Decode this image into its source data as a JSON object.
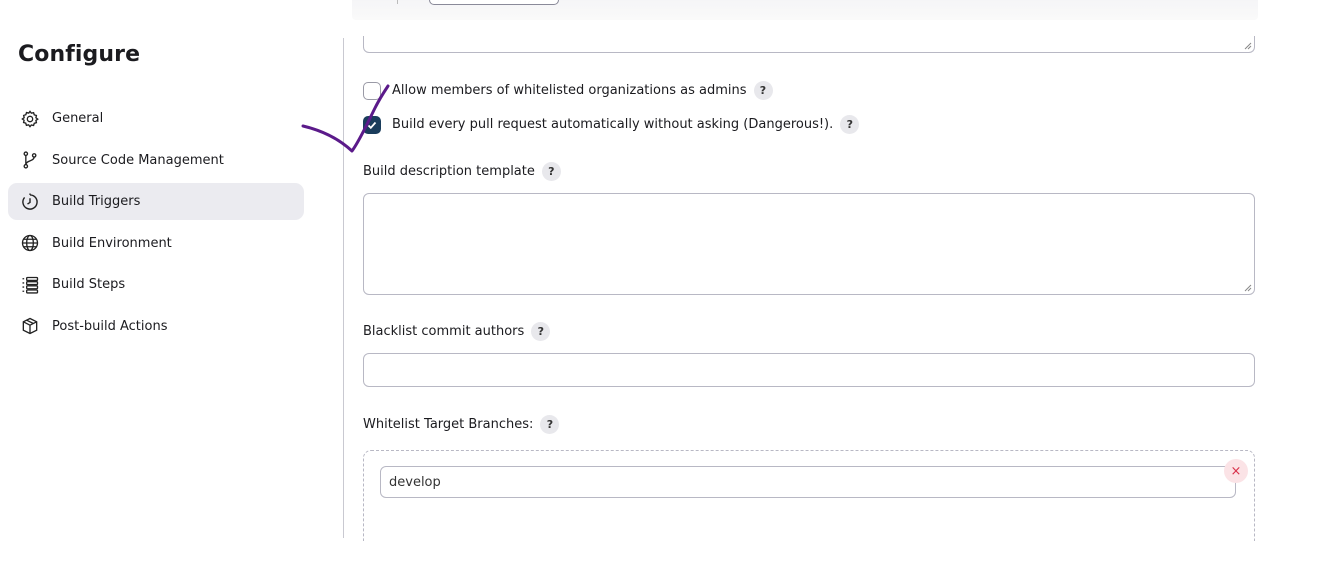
{
  "page": {
    "title": "Configure"
  },
  "sidebar": {
    "items": [
      {
        "label": "General",
        "icon": "gear-icon"
      },
      {
        "label": "Source Code Management",
        "icon": "branch-icon"
      },
      {
        "label": "Build Triggers",
        "icon": "clock-icon",
        "active": true
      },
      {
        "label": "Build Environment",
        "icon": "globe-icon"
      },
      {
        "label": "Build Steps",
        "icon": "list-icon"
      },
      {
        "label": "Post-build Actions",
        "icon": "package-icon"
      }
    ]
  },
  "form": {
    "allow_whitelisted_admins": {
      "label": "Allow members of whitelisted organizations as admins",
      "checked": false,
      "help": "?"
    },
    "build_every_pr": {
      "label": "Build every pull request automatically without asking (Dangerous!).",
      "checked": true,
      "help": "?"
    },
    "build_description_template": {
      "label": "Build description template",
      "help": "?",
      "value": ""
    },
    "blacklist_commit_authors": {
      "label": "Blacklist commit authors",
      "help": "?",
      "value": ""
    },
    "whitelist_target_branches": {
      "label": "Whitelist Target Branches:",
      "help": "?",
      "entries": [
        {
          "value": "develop",
          "remove": "×"
        }
      ]
    }
  },
  "colors": {
    "accent": "#1a3d5c",
    "active_nav_bg": "#ebebf0",
    "annotation_stroke": "#5b1a8a",
    "remove_button": "#d8304a"
  }
}
